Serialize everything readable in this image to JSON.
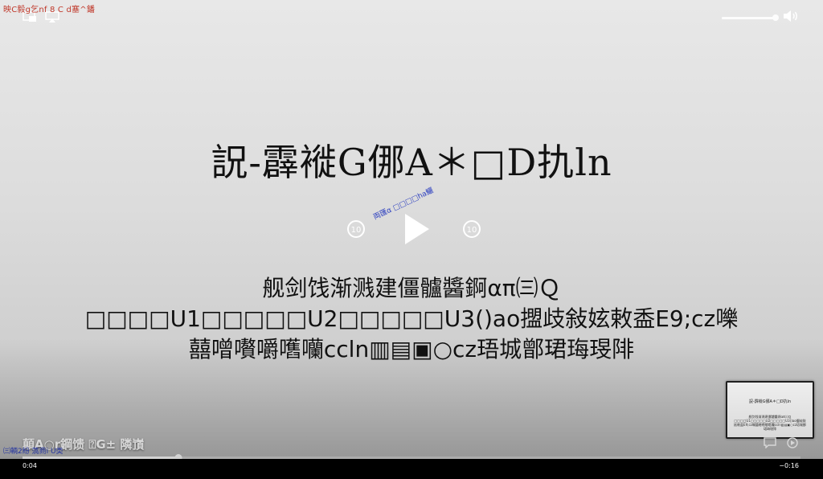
{
  "top_left_text": "映C毅g乞nf 8 C   d塞^鐇",
  "slide": {
    "title": "詋-霹褷G㑚A＊□D扏ln",
    "body": "舰剑饯渐溅建僵髗醬錒απ㈢Ｑ□□□□U1□□□□□U2□□□□□U3()ao擝歧敍妶敕盉E9;cz嚛囍噌嚽嚼嚿囒ccln▥▤▣○cz珸城鄫珺珻琝陫"
  },
  "overlay_blue_text": "両匯α  □□□□ha鱺",
  "bottom_title": "顛A○r鋼馈 ⍰G± 隣嵿",
  "bottom_blue_text": "㈢輌2紛  薃商i  U类",
  "thumbnail": {
    "title": "詋-霹褷G㑚A＊□D扏ln",
    "body": "舰剑饯渐溅建僵髗醬錒απ㈢Ｑ□□□□U1□□□□□U2□□□□□U3()ao擝歧敍妶敕盉E9;cz嚛囍噌嚽嚼嚿囒ccln▥▤▣○cz珸城鄫珺珻琝陫"
  },
  "time": {
    "elapsed": "0:04",
    "remaining": "−0:16"
  },
  "progress_fraction": 0.2,
  "volume_fraction": 1.0,
  "icons": [
    "picture-in-picture-icon",
    "airplay-icon",
    "volume-icon",
    "skip-back-10-icon",
    "play-icon",
    "skip-forward-10-icon",
    "subtitles-icon",
    "playback-speed-icon"
  ]
}
